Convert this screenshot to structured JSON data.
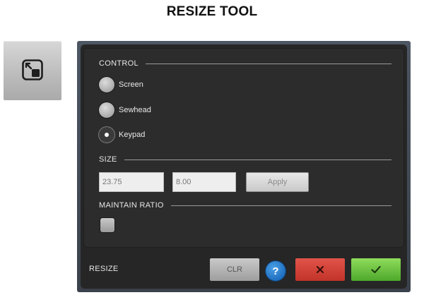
{
  "page": {
    "title": "RESIZE TOOL"
  },
  "tool_tile": {
    "icon": "resize-icon"
  },
  "dialog": {
    "control_section": {
      "label": "CONTROL",
      "options": [
        {
          "label": "Screen",
          "selected": false
        },
        {
          "label": "Sewhead",
          "selected": false
        },
        {
          "label": "Keypad",
          "selected": true
        }
      ]
    },
    "size_section": {
      "label": "SIZE",
      "width_value": "23.75",
      "height_value": "8.00",
      "apply_label": "Apply"
    },
    "ratio_section": {
      "label": "MAINTAIN RATIO",
      "checked": false
    },
    "footer": {
      "label": "RESIZE",
      "clr_label": "CLR",
      "help_label": "?",
      "cancel_icon": "close-icon",
      "ok_icon": "checkmark-icon"
    }
  },
  "colors": {
    "panel_bg": "#2c2c2c",
    "help_blue": "#1f6fc0",
    "cancel_red": "#c23329",
    "ok_green": "#4ea82b"
  }
}
